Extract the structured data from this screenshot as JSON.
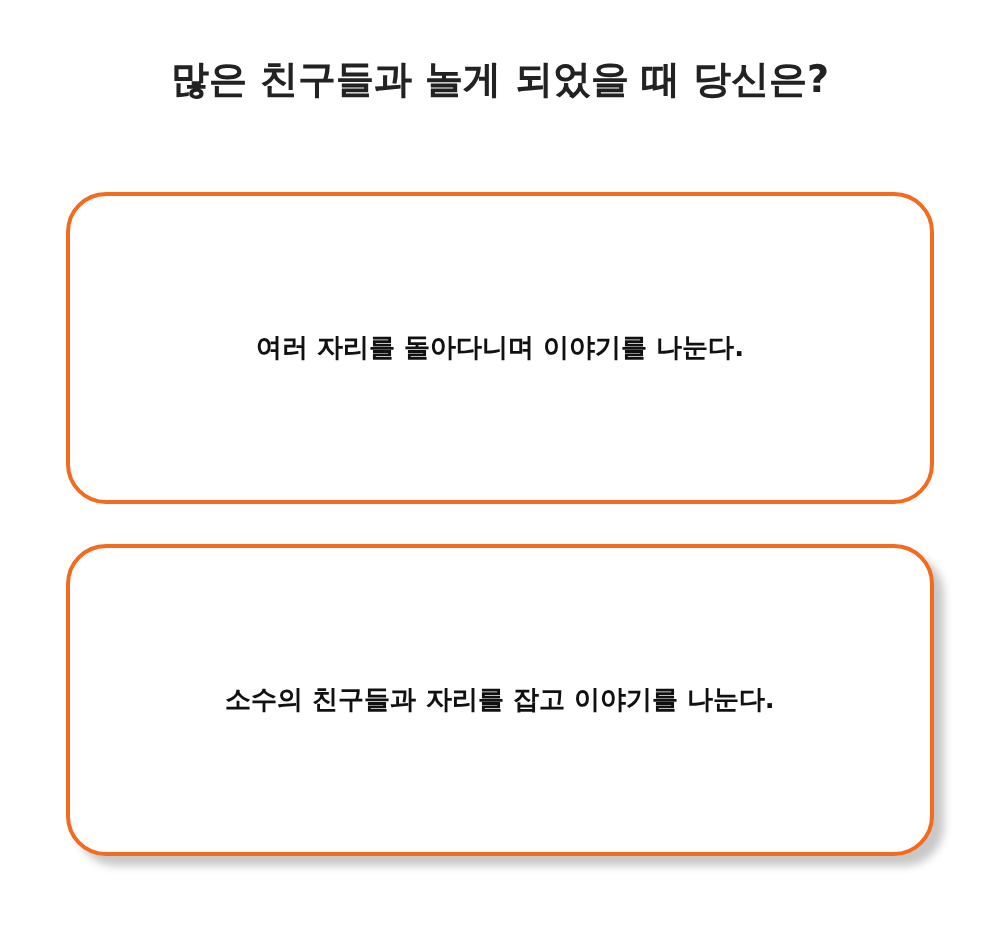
{
  "question": "많은 친구들과 놀게 되었을 때 당신은?",
  "options": [
    {
      "label": "여러 자리를 돌아다니며 이야기를 나눈다.",
      "selected": false
    },
    {
      "label": "소수의 친구들과 자리를 잡고 이야기를 나눈다.",
      "selected": true
    }
  ]
}
